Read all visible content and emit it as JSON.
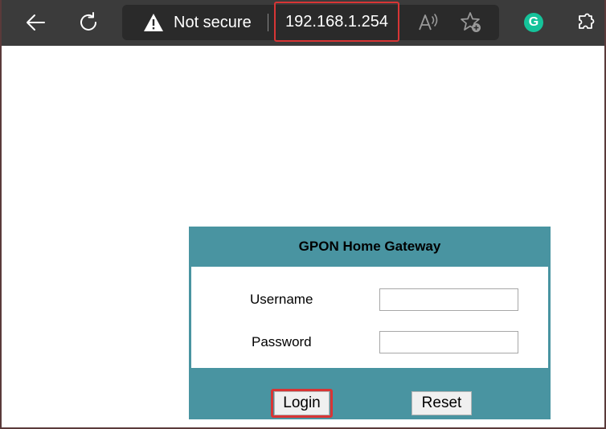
{
  "browser": {
    "security_label": "Not secure",
    "url": "192.168.1.254",
    "icons": {
      "back": "back-arrow-icon",
      "refresh": "refresh-icon",
      "security": "warning-icon",
      "read_aloud": "read-aloud-icon",
      "favorites": "add-favorite-icon",
      "extension": "grammarly-icon",
      "extensions_menu": "extensions-icon"
    },
    "grammarly_letter": "G"
  },
  "login_panel": {
    "title": "GPON Home Gateway",
    "username_label": "Username",
    "username_value": "",
    "password_label": "Password",
    "password_value": "",
    "login_label": "Login",
    "reset_label": "Reset"
  },
  "colors": {
    "toolbar_bg": "#3b3b3b",
    "address_bg": "#2a2a2a",
    "panel_bg": "#4994a1",
    "highlight": "#d83535",
    "grammarly": "#15c39a"
  }
}
